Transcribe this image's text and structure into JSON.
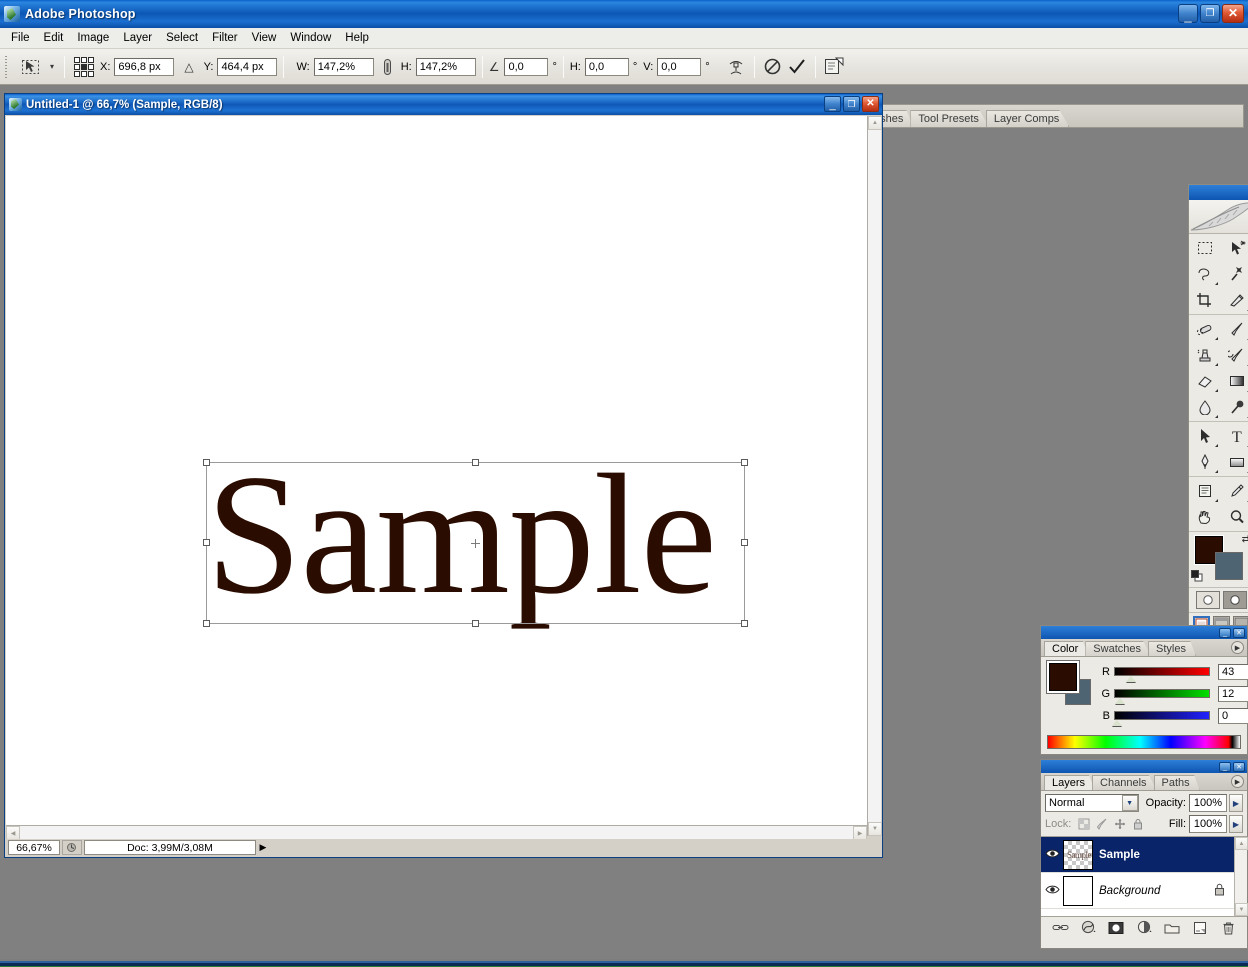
{
  "app": {
    "title": "Adobe Photoshop",
    "logo_icon": "photoshop-logo-icon",
    "window_buttons": {
      "minimize": "_",
      "maximize": "❐",
      "close": "✕"
    }
  },
  "menubar": {
    "items": [
      {
        "label": "File"
      },
      {
        "label": "Edit"
      },
      {
        "label": "Image"
      },
      {
        "label": "Layer"
      },
      {
        "label": "Select"
      },
      {
        "label": "Filter"
      },
      {
        "label": "View"
      },
      {
        "label": "Window"
      },
      {
        "label": "Help"
      }
    ]
  },
  "options_bar": {
    "active_tool_icon": "move-tool-icon",
    "tool_preset_caret": "▾",
    "reference_point_label": "reference-point-grid",
    "fields": [
      {
        "name": "x-position",
        "label": "X:",
        "value": "696,8 px",
        "unit": ""
      },
      {
        "name": "y-position",
        "label": "Y:",
        "value": "464,4 px",
        "unit": ""
      },
      {
        "name": "width-scale",
        "label": "W:",
        "value": "147,2%",
        "unit": ""
      },
      {
        "name": "height-scale",
        "label": "H:",
        "value": "147,2%",
        "unit": ""
      },
      {
        "name": "rotation",
        "label": "",
        "value": "0,0",
        "unit": "°"
      },
      {
        "name": "skew-horizontal",
        "label": "H:",
        "value": "0,0",
        "unit": "°"
      },
      {
        "name": "skew-vertical",
        "label": "V:",
        "value": "0,0",
        "unit": "°"
      }
    ],
    "delta_symbol": "△",
    "skew_symbol": "∠",
    "link_icon": "link-wh-icon",
    "buttons": [
      {
        "name": "warp-mode-button",
        "icon": "warp-icon"
      },
      {
        "name": "cancel-transform-button",
        "icon": "cancel-icon"
      },
      {
        "name": "commit-transform-button",
        "icon": "checkmark-icon"
      },
      {
        "name": "toggle-image-ready-button",
        "icon": "jump-to-icon"
      }
    ],
    "palette_well_tabs": [
      {
        "label": "Brushes"
      },
      {
        "label": "Tool Presets"
      },
      {
        "label": "Layer Comps"
      }
    ]
  },
  "document": {
    "title": "Untitled-1 @ 66,7% (Sample, RGB/8)",
    "window_buttons": {
      "minimize": "_",
      "maximize": "❐",
      "close": "✕"
    },
    "canvas_text": "Sample",
    "canvas_text_color": "#2B0C00",
    "status": {
      "zoom": "66,67%",
      "doc_icon": "doc-info-icon",
      "doc_size": "Doc: 3,99M/3,08M",
      "more_arrow": "▶"
    },
    "transform_box": {
      "handles": 8,
      "reference_point_icon": "transform-reference-point-icon"
    }
  },
  "toolbox": {
    "banner_icon": "feather-banner-icon",
    "groups": [
      {
        "tools": [
          {
            "name": "rectangular-marquee-tool",
            "icon": "marquee-icon",
            "has_flyout": false
          },
          {
            "name": "move-tool",
            "icon": "move-tool-icon",
            "has_flyout": false,
            "selected": false
          },
          {
            "name": "lasso-tool",
            "icon": "lasso-icon",
            "has_flyout": true
          },
          {
            "name": "magic-wand-tool",
            "icon": "magic-wand-icon",
            "has_flyout": false
          },
          {
            "name": "crop-tool",
            "icon": "crop-icon",
            "has_flyout": false
          },
          {
            "name": "slice-tool",
            "icon": "slice-icon",
            "has_flyout": true
          }
        ]
      },
      {
        "tools": [
          {
            "name": "healing-brush-tool",
            "icon": "healing-brush-icon",
            "has_flyout": true
          },
          {
            "name": "brush-tool",
            "icon": "brush-icon",
            "has_flyout": true
          },
          {
            "name": "clone-stamp-tool",
            "icon": "clone-stamp-icon",
            "has_flyout": true
          },
          {
            "name": "history-brush-tool",
            "icon": "history-brush-icon",
            "has_flyout": true
          },
          {
            "name": "eraser-tool",
            "icon": "eraser-icon",
            "has_flyout": true
          },
          {
            "name": "gradient-tool",
            "icon": "gradient-icon",
            "has_flyout": true
          },
          {
            "name": "blur-tool",
            "icon": "blur-drop-icon",
            "has_flyout": true
          },
          {
            "name": "dodge-tool",
            "icon": "dodge-icon",
            "has_flyout": true
          }
        ]
      },
      {
        "tools": [
          {
            "name": "path-selection-tool",
            "icon": "path-arrow-icon",
            "has_flyout": true
          },
          {
            "name": "type-tool",
            "icon": "type-t-icon",
            "has_flyout": true
          },
          {
            "name": "pen-tool",
            "icon": "pen-icon",
            "has_flyout": true
          },
          {
            "name": "rectangle-shape-tool",
            "icon": "shape-rect-icon",
            "has_flyout": true
          }
        ]
      },
      {
        "tools": [
          {
            "name": "notes-tool",
            "icon": "notes-icon",
            "has_flyout": true
          },
          {
            "name": "eyedropper-tool",
            "icon": "eyedropper-icon",
            "has_flyout": true
          },
          {
            "name": "hand-tool",
            "icon": "hand-icon",
            "has_flyout": false
          },
          {
            "name": "zoom-tool",
            "icon": "magnifier-icon",
            "has_flyout": false
          }
        ]
      }
    ],
    "colors": {
      "foreground": "#2B0C00",
      "background": "#4E6472",
      "swap_icon": "swap-colors-icon",
      "default_icon": "default-colors-icon"
    },
    "quick_mask": [
      {
        "name": "standard-mode-button",
        "icon": "standard-mode-icon",
        "active": true
      },
      {
        "name": "quick-mask-mode-button",
        "icon": "quick-mask-icon",
        "active": false
      }
    ],
    "screen_modes": [
      {
        "name": "standard-screen-mode-button",
        "icon": "screen-standard-icon",
        "active": true
      },
      {
        "name": "full-screen-menubar-button",
        "icon": "screen-menubar-icon",
        "active": false
      },
      {
        "name": "full-screen-mode-button",
        "icon": "screen-full-icon",
        "active": false
      }
    ],
    "jump_to": [
      {
        "name": "jump-to-imageready-button",
        "icon": "jump-to-imageready-icon"
      },
      {
        "name": "imageready-logo",
        "icon": "imageready-icon"
      }
    ]
  },
  "color_palette": {
    "tabs": [
      {
        "label": "Color",
        "active": true
      },
      {
        "label": "Swatches",
        "active": false
      },
      {
        "label": "Styles",
        "active": false
      }
    ],
    "menu_icon": "palette-menu-icon",
    "window_buttons": {
      "minimize": "_",
      "close": "✕"
    },
    "channels": [
      {
        "label": "R",
        "value": "43",
        "max": 255
      },
      {
        "label": "G",
        "value": "12",
        "max": 255
      },
      {
        "label": "B",
        "value": "0",
        "max": 255
      }
    ],
    "foreground": "#2B0C00",
    "background": "#4E6472",
    "spectrum_name": "color-spectrum-ramp"
  },
  "layers_palette": {
    "tabs": [
      {
        "label": "Layers",
        "active": true
      },
      {
        "label": "Channels",
        "active": false
      },
      {
        "label": "Paths",
        "active": false
      }
    ],
    "menu_icon": "palette-menu-icon",
    "window_buttons": {
      "minimize": "_",
      "close": "✕"
    },
    "blend_mode": "Normal",
    "blend_mode_caret": "▼",
    "opacity_label": "Opacity:",
    "opacity_value": "100%",
    "fill_label": "Fill:",
    "fill_value": "100%",
    "lock_label": "Lock:",
    "lock_icons": [
      {
        "name": "lock-transparent-pixels-icon"
      },
      {
        "name": "lock-image-pixels-icon"
      },
      {
        "name": "lock-position-icon"
      },
      {
        "name": "lock-all-icon"
      }
    ],
    "layers": [
      {
        "name": "Sample",
        "selected": true,
        "visible": true,
        "thumbnail": "transparent-checker-thumbnail",
        "thumbnail_text": "Sample",
        "locked": false,
        "italic": false
      },
      {
        "name": "Background",
        "selected": false,
        "visible": true,
        "thumbnail": "white-thumbnail",
        "thumbnail_text": "",
        "locked": true,
        "italic": true
      }
    ],
    "footer_buttons": [
      {
        "name": "link-layers-button",
        "icon": "link-icon"
      },
      {
        "name": "add-layer-style-button",
        "icon": "fx-icon"
      },
      {
        "name": "add-layer-mask-button",
        "icon": "mask-icon"
      },
      {
        "name": "new-fill-adjustment-layer-button",
        "icon": "adjustment-circle-icon"
      },
      {
        "name": "new-group-button",
        "icon": "folder-icon"
      },
      {
        "name": "new-layer-button",
        "icon": "new-layer-icon"
      },
      {
        "name": "delete-layer-button",
        "icon": "trash-icon"
      }
    ]
  },
  "theme": {
    "workspace_background": "#808080",
    "title_blue": "#0F58B8",
    "panel_face": "#ECEAE4",
    "selection_blue": "#0A246A"
  }
}
